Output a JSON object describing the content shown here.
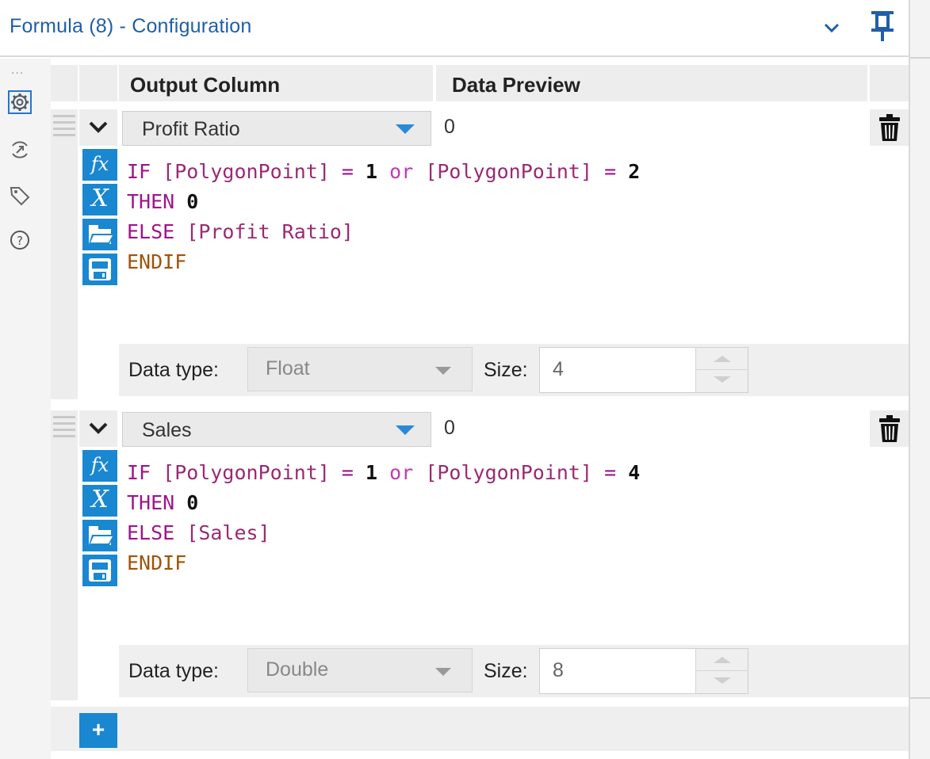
{
  "window": {
    "title": "Formula (8) - Configuration"
  },
  "header": {
    "output_column": "Output Column",
    "data_preview": "Data Preview"
  },
  "formulas": [
    {
      "column": "Profit Ratio",
      "preview": "0",
      "expression": [
        [
          "IF ",
          "[PolygonPoint]",
          " = ",
          "1",
          " or ",
          "[PolygonPoint]",
          " = ",
          "2"
        ],
        [
          "THEN ",
          "0"
        ],
        [
          "ELSE ",
          "[Profit Ratio]"
        ],
        [
          "ENDIF"
        ]
      ],
      "data_type_label": "Data type:",
      "data_type": "Float",
      "size_label": "Size:",
      "size": "4"
    },
    {
      "column": "Sales",
      "preview": "0",
      "expression": [
        [
          "IF ",
          "[PolygonPoint]",
          " = ",
          "1",
          " or ",
          "[PolygonPoint]",
          " = ",
          "4"
        ],
        [
          "THEN ",
          "0"
        ],
        [
          "ELSE ",
          "[Sales]"
        ],
        [
          "ENDIF"
        ]
      ],
      "data_type_label": "Data type:",
      "data_type": "Double",
      "size_label": "Size:",
      "size": "8"
    }
  ],
  "rail": {
    "dots": "...",
    "icons": [
      "gear-icon",
      "connection-icon",
      "tag-icon",
      "help-icon"
    ]
  },
  "tools": {
    "fx": "fx",
    "x": "X"
  },
  "add_button": "+",
  "colors": {
    "accent": "#1a87d1",
    "title": "#1f5fa8",
    "keyword": "#a0148a",
    "field": "#9a2a74"
  }
}
